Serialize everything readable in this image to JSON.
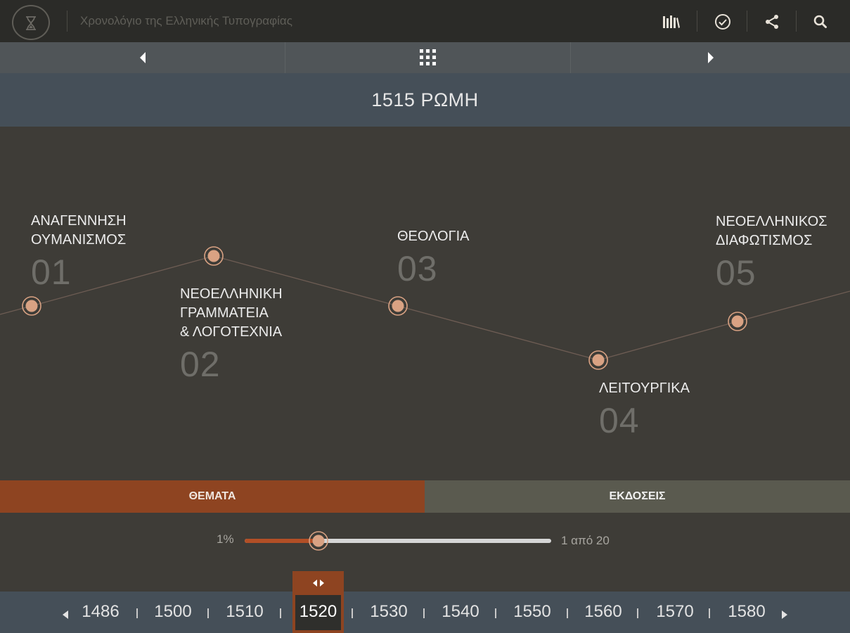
{
  "header": {
    "title": "Χρονολόγιο της Ελληνικής Τυπογραφίας",
    "icons": [
      "hourglass-logo-icon",
      "library-books-icon",
      "check-circle-icon",
      "share-icon",
      "search-icon"
    ]
  },
  "navbar": {
    "icons": [
      "prev-arrow-icon",
      "grid-menu-icon",
      "next-arrow-icon"
    ]
  },
  "current": {
    "heading": "1515 ΡΩΜΗ"
  },
  "topics": [
    {
      "line1": "ΑΝΑΓΕΝΝΗΣΗ",
      "line2": "ΟΥΜΑΝΙΣΜΟΣ",
      "line3": "",
      "number": "01"
    },
    {
      "line1": "ΝΕΟΕΛΛΗΝΙΚΗ",
      "line2": "ΓΡΑΜΜΑΤΕΙΑ",
      "line3": "& ΛΟΓΟΤΕΧΝΙΑ",
      "number": "02"
    },
    {
      "line1": "ΘΕΟΛΟΓΙΑ",
      "line2": "",
      "line3": "",
      "number": "03"
    },
    {
      "line1": "ΛΕΙΤΟΥΡΓΙΚΑ",
      "line2": "",
      "line3": "",
      "number": "04"
    },
    {
      "line1": "ΝΕΟΕΛΛΗΝΙΚΟΣ",
      "line2": "ΔΙΑΦΩΤΙΣΜΟΣ",
      "line3": "",
      "number": "05"
    }
  ],
  "tabs": {
    "topics": "ΘΕΜΑΤΑ",
    "editions": "ΕΚΔΟΣΕΙΣ",
    "active": "topics"
  },
  "slider": {
    "percent_label": "1%",
    "count_label": "1 από 20",
    "progress": 0.24
  },
  "years": {
    "items": [
      "1486",
      "1500",
      "1510",
      "1520",
      "1530",
      "1540",
      "1550",
      "1560",
      "1570",
      "1580"
    ],
    "active": "1520"
  },
  "colors": {
    "accent": "#8e4421",
    "node": "#d9a283",
    "header_bg": "#2b2b28",
    "band_bg": "#454f58",
    "body_bg": "#3e3c37"
  }
}
